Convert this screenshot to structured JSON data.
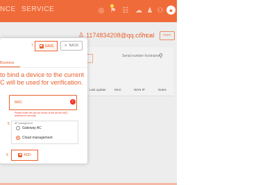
{
  "topbar": {
    "nav": [
      "NCE",
      "SERVICE"
    ]
  },
  "header": {
    "account": "1174834208@qq.com",
    "network": "cal",
    "more_label": "more"
  },
  "background": {
    "add_label": "Add",
    "search_placeholder": "Serial number hostname",
    "columns": [
      "Last update",
      "MAC",
      "WAN IP",
      "Notes"
    ]
  },
  "dialog": {
    "save_label": "SAVE",
    "back_label": "BACK",
    "save_step": "7",
    "title": "Business",
    "bind_text_line1": "to bind a device to the current",
    "bind_text_line2": "C will be used for verification.",
    "mac_label": "MAC",
    "mac_hint": "Please enter the last six hexes of the device MAC address for security.",
    "management_title": "AP management",
    "management_step": "5",
    "options": [
      {
        "label": "Gateway AC",
        "checked": false
      },
      {
        "label": "Cloud management",
        "checked": true
      }
    ],
    "add_step": "6",
    "add_label": "ADD"
  },
  "colors": {
    "accent": "#f06b3a",
    "error": "#f13a2a"
  }
}
